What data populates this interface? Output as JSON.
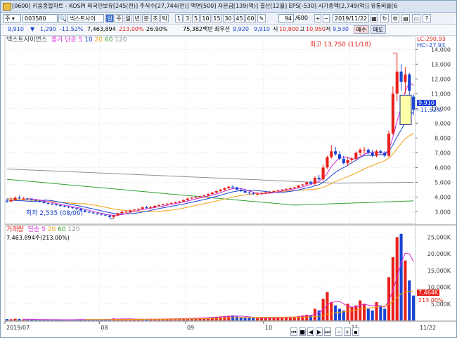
{
  "window": {
    "title": "[0600] 키움종합차트 - KOSPI 외국인보유[245(천)] 주식수[27,744(천)] 액면[500] 자본금[139(억)] 결산[12월] EPS[-530] 시가총액[2,749(억)] 유통비율[6"
  },
  "toolbar": {
    "mode": "주",
    "code": "003580",
    "stock_name": "넥스트사이",
    "period_buttons": [
      "일",
      "주",
      "월",
      "년",
      "분",
      "초",
      "틱"
    ],
    "interval_buttons": [
      "1",
      "3",
      "5",
      "10",
      "15",
      "30",
      "45",
      "60"
    ],
    "count_value": "94",
    "count_total": "/600",
    "date": "2019/11/22",
    "buy_label": "매수",
    "sell_label": "매도"
  },
  "quote": {
    "price": "9,910",
    "change": "1,290",
    "change_pct": "-11.52%",
    "volume": "7,463,894",
    "volume_pct": "213.00%",
    "turnover": "26.90%",
    "trade_value": "75,382백만",
    "priority_label": "최우선",
    "best_ask": "9,920",
    "best_bid": "9,910",
    "open_label": "시",
    "open": "10,800",
    "high_label": "고",
    "high": "10,950",
    "low_label": "저",
    "low": "9,530"
  },
  "price_pane": {
    "legend_name": "넥스트사이언스",
    "legend_ma": [
      "종가 단순",
      "5",
      "10",
      "20",
      "60",
      "120"
    ],
    "lc": "LC:290.93",
    "hc": "HC:-27.93",
    "high_note": "최고 13,750 (11/18)",
    "low_note": "최저 2,535 (08/06)",
    "last_price": "9,910",
    "last_pct": "-11.52%",
    "ticks": [
      "14,000",
      "13,000",
      "12,000",
      "11,000",
      "10,000",
      "9,000",
      "8,000",
      "7,000",
      "6,000",
      "5,000",
      "4,000",
      "3,000"
    ]
  },
  "volume_pane": {
    "legend_name": "거래량",
    "legend_ma": [
      "단순",
      "5",
      "20",
      "60",
      "120"
    ],
    "sub": "7,463,894주(213.00%)",
    "last_vol": "7,464K",
    "last_pct": "213.00%",
    "ticks": [
      "25,000K",
      "20,000K",
      "15,000K",
      "10,000K",
      "5,000K"
    ]
  },
  "x_axis": {
    "labels": [
      "2019/07",
      "08",
      "09",
      "10",
      "11"
    ],
    "right_label": "11/22"
  },
  "colors": {
    "up": "#e8201a",
    "down": "#1a44d4",
    "ma5": "#d82ad8",
    "ma10": "#1a44d4",
    "ma20": "#f0a010",
    "ma60": "#30a030",
    "ma120": "#909090"
  },
  "chart_data": {
    "type": "candlestick",
    "x": [
      "07/01",
      "07/02",
      "07/03",
      "07/04",
      "07/05",
      "07/08",
      "07/09",
      "07/10",
      "07/11",
      "07/12",
      "07/15",
      "07/16",
      "07/17",
      "07/18",
      "07/19",
      "07/22",
      "07/23",
      "07/24",
      "07/25",
      "07/26",
      "07/29",
      "07/30",
      "07/31",
      "08/01",
      "08/02",
      "08/05",
      "08/06",
      "08/07",
      "08/08",
      "08/09",
      "08/12",
      "08/13",
      "08/14",
      "08/16",
      "08/19",
      "08/20",
      "08/21",
      "08/22",
      "08/23",
      "08/26",
      "08/27",
      "08/28",
      "08/29",
      "08/30",
      "09/02",
      "09/03",
      "09/04",
      "09/05",
      "09/06",
      "09/09",
      "09/10",
      "09/11",
      "09/16",
      "09/17",
      "09/18",
      "09/19",
      "09/20",
      "09/23",
      "09/24",
      "09/25",
      "09/26",
      "09/27",
      "09/30",
      "10/01",
      "10/02",
      "10/04",
      "10/07",
      "10/08",
      "10/10",
      "10/11",
      "10/14",
      "10/15",
      "10/16",
      "10/17",
      "10/18",
      "10/21",
      "10/22",
      "10/23",
      "10/24",
      "10/25",
      "10/28",
      "10/29",
      "10/30",
      "10/31",
      "11/01",
      "11/04",
      "11/05",
      "11/06",
      "11/07",
      "11/08",
      "11/11",
      "11/12",
      "11/13",
      "11/14",
      "11/15",
      "11/18",
      "11/19",
      "11/20",
      "11/21",
      "11/22"
    ],
    "open": [
      3750,
      3700,
      3800,
      3950,
      3900,
      3900,
      3850,
      3800,
      3750,
      3700,
      3600,
      3550,
      3500,
      3450,
      3400,
      3350,
      3300,
      3250,
      3200,
      3100,
      3000,
      2950,
      2900,
      2850,
      2800,
      2750,
      2650,
      2750,
      2900,
      3000,
      3000,
      3100,
      3150,
      3200,
      3300,
      3250,
      3300,
      3400,
      3450,
      3500,
      3550,
      3600,
      3650,
      3700,
      3800,
      3900,
      3950,
      4000,
      4050,
      4100,
      4200,
      4300,
      4400,
      4500,
      4600,
      4700,
      4650,
      4500,
      4400,
      4300,
      4250,
      4200,
      4200,
      4250,
      4300,
      4350,
      4400,
      4450,
      4500,
      4550,
      4600,
      4650,
      4800,
      4850,
      5000,
      4900,
      5300,
      5200,
      6000,
      6700,
      7100,
      6900,
      6600,
      6300,
      6500,
      6600,
      7000,
      7200,
      7200,
      7000,
      6800,
      7100,
      7000,
      6800,
      8300,
      11000,
      12500,
      11800,
      12300,
      10800
    ],
    "high": [
      3900,
      3950,
      4050,
      4100,
      4000,
      3950,
      3900,
      3850,
      3800,
      3750,
      3650,
      3600,
      3550,
      3500,
      3450,
      3400,
      3350,
      3300,
      3250,
      3150,
      3050,
      3000,
      2950,
      2900,
      2850,
      2800,
      2800,
      2950,
      3050,
      3100,
      3150,
      3200,
      3250,
      3350,
      3400,
      3400,
      3450,
      3500,
      3550,
      3600,
      3650,
      3700,
      3750,
      3850,
      3950,
      4000,
      4050,
      4100,
      4150,
      4250,
      4350,
      4450,
      4550,
      4650,
      4750,
      4800,
      4700,
      4600,
      4500,
      4400,
      4350,
      4300,
      4300,
      4350,
      4400,
      4450,
      4500,
      4550,
      4600,
      4650,
      4700,
      4800,
      4900,
      5000,
      5100,
      5400,
      5500,
      6200,
      6800,
      7500,
      7400,
      7100,
      6800,
      6700,
      6700,
      7100,
      7300,
      7400,
      7300,
      7200,
      7200,
      7200,
      7100,
      8500,
      11500,
      13750,
      13000,
      12800,
      12400,
      10950
    ],
    "low": [
      3600,
      3650,
      3750,
      3850,
      3800,
      3800,
      3750,
      3700,
      3650,
      3550,
      3500,
      3450,
      3400,
      3350,
      3300,
      3250,
      3200,
      3100,
      3000,
      2950,
      2900,
      2850,
      2800,
      2750,
      2700,
      2600,
      2535,
      2700,
      2850,
      2900,
      2950,
      3050,
      3100,
      3150,
      3200,
      3200,
      3250,
      3350,
      3400,
      3450,
      3500,
      3550,
      3600,
      3650,
      3750,
      3850,
      3900,
      3950,
      4000,
      4050,
      4150,
      4250,
      4350,
      4450,
      4550,
      4600,
      4450,
      4350,
      4250,
      4150,
      4150,
      4100,
      4150,
      4200,
      4250,
      4300,
      4350,
      4400,
      4450,
      4500,
      4550,
      4600,
      4750,
      4800,
      4850,
      4800,
      5100,
      5100,
      5900,
      6600,
      6800,
      6500,
      6200,
      6100,
      6300,
      6500,
      6800,
      6900,
      6900,
      6700,
      6700,
      6900,
      6700,
      6700,
      8200,
      10500,
      11200,
      11000,
      10500,
      9530
    ],
    "close": [
      3700,
      3800,
      3950,
      3900,
      3900,
      3850,
      3800,
      3750,
      3700,
      3600,
      3550,
      3500,
      3450,
      3400,
      3350,
      3300,
      3250,
      3200,
      3100,
      3000,
      2950,
      2900,
      2850,
      2800,
      2750,
      2650,
      2750,
      2900,
      3000,
      3000,
      3100,
      3150,
      3200,
      3300,
      3250,
      3300,
      3400,
      3450,
      3500,
      3550,
      3600,
      3650,
      3700,
      3800,
      3900,
      3950,
      4000,
      4050,
      4100,
      4200,
      4300,
      4400,
      4500,
      4600,
      4700,
      4650,
      4500,
      4400,
      4300,
      4250,
      4200,
      4200,
      4250,
      4300,
      4350,
      4400,
      4450,
      4500,
      4550,
      4600,
      4650,
      4800,
      4850,
      5000,
      4900,
      5300,
      5200,
      6000,
      6700,
      7100,
      6900,
      6600,
      6300,
      6500,
      6600,
      7000,
      7200,
      7200,
      7000,
      6800,
      7100,
      7000,
      6800,
      8300,
      11000,
      12500,
      11800,
      12300,
      11200,
      9910
    ],
    "volume_k": [
      400,
      350,
      500,
      450,
      300,
      280,
      260,
      240,
      230,
      250,
      220,
      210,
      200,
      190,
      210,
      230,
      240,
      260,
      300,
      280,
      260,
      270,
      290,
      300,
      320,
      350,
      600,
      500,
      450,
      420,
      380,
      360,
      340,
      360,
      380,
      400,
      420,
      450,
      480,
      500,
      520,
      540,
      560,
      600,
      650,
      700,
      750,
      800,
      850,
      900,
      1000,
      1100,
      1200,
      1300,
      1400,
      1500,
      1200,
      1000,
      900,
      800,
      750,
      700,
      700,
      750,
      800,
      850,
      900,
      950,
      1000,
      1050,
      1100,
      1300,
      1500,
      1700,
      1600,
      3500,
      3000,
      6500,
      8500,
      5500,
      4500,
      3500,
      3000,
      5000,
      4000,
      4500,
      6000,
      5000,
      3500,
      3000,
      5500,
      4500,
      3500,
      13000,
      19000,
      25000,
      26000,
      18000,
      12000,
      7464
    ],
    "y_label": "",
    "ylim": [
      2400,
      14300
    ],
    "volume_ylim": [
      0,
      27000
    ]
  }
}
